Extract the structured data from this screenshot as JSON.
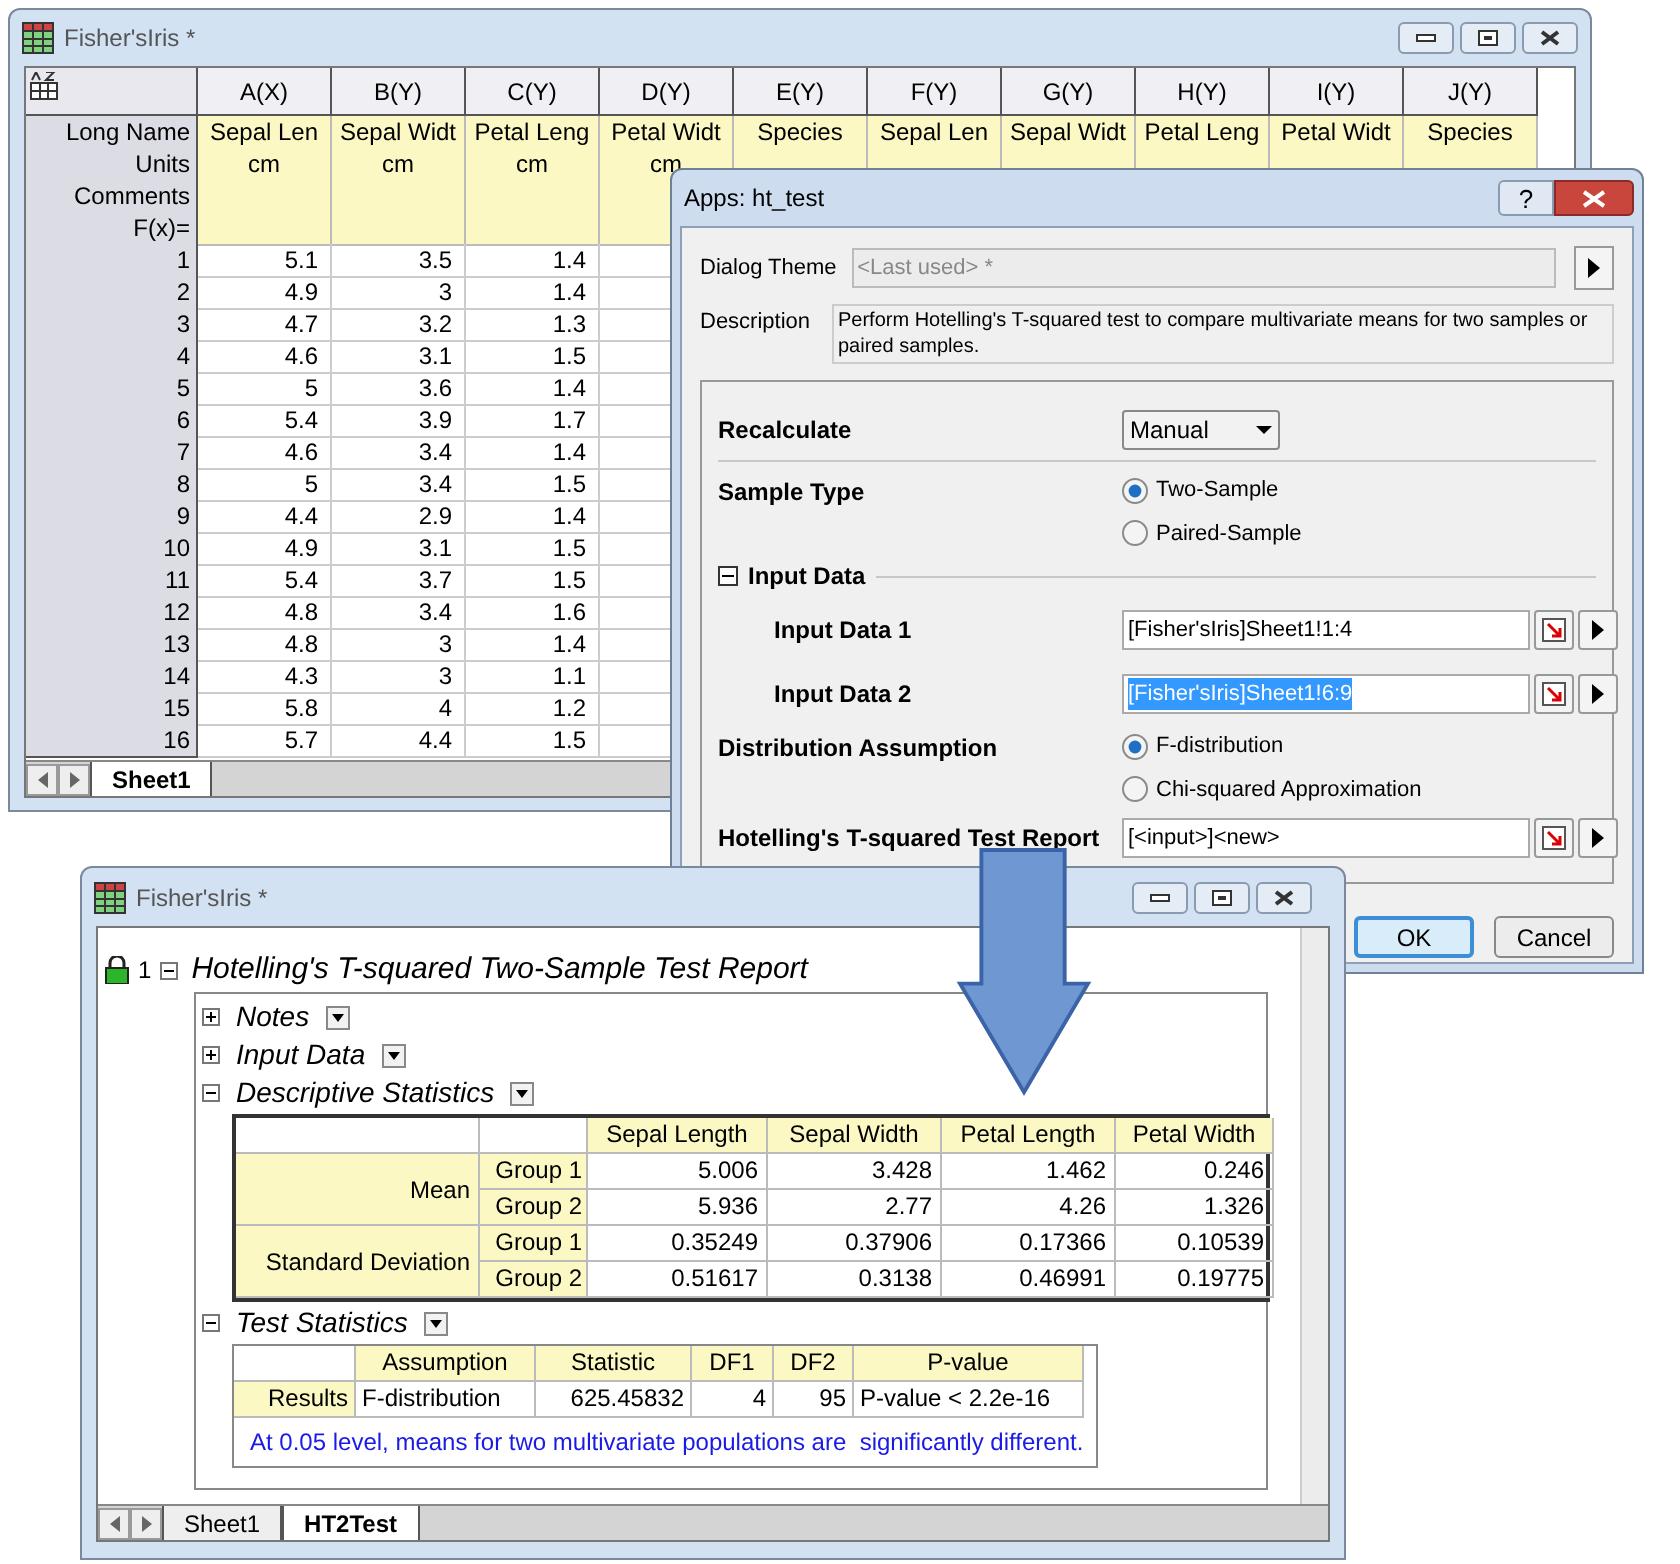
{
  "sheet_window": {
    "title": "Fisher'sIris *",
    "columns": [
      "A(X)",
      "B(Y)",
      "C(Y)",
      "D(Y)",
      "E(Y)",
      "F(Y)",
      "G(Y)",
      "H(Y)",
      "I(Y)",
      "J(Y)"
    ],
    "label_rows": [
      {
        "label": "Long Name",
        "values": [
          "Sepal Len",
          "Sepal Widt",
          "Petal Leng",
          "Petal Widt",
          "Species",
          "Sepal Len",
          "Sepal Widt",
          "Petal Leng",
          "Petal Widt",
          "Species"
        ]
      },
      {
        "label": "Units",
        "values": [
          "cm",
          "cm",
          "cm",
          "cm"
        ]
      },
      {
        "label": "Comments",
        "values": []
      },
      {
        "label": "F(x)=",
        "values": []
      }
    ],
    "rows": [
      {
        "label": "1",
        "values": [
          "5.1",
          "3.5",
          "1.4"
        ]
      },
      {
        "label": "2",
        "values": [
          "4.9",
          "3",
          "1.4"
        ]
      },
      {
        "label": "3",
        "values": [
          "4.7",
          "3.2",
          "1.3"
        ]
      },
      {
        "label": "4",
        "values": [
          "4.6",
          "3.1",
          "1.5"
        ]
      },
      {
        "label": "5",
        "values": [
          "5",
          "3.6",
          "1.4"
        ]
      },
      {
        "label": "6",
        "values": [
          "5.4",
          "3.9",
          "1.7"
        ]
      },
      {
        "label": "7",
        "values": [
          "4.6",
          "3.4",
          "1.4"
        ]
      },
      {
        "label": "8",
        "values": [
          "5",
          "3.4",
          "1.5"
        ]
      },
      {
        "label": "9",
        "values": [
          "4.4",
          "2.9",
          "1.4"
        ]
      },
      {
        "label": "10",
        "values": [
          "4.9",
          "3.1",
          "1.5"
        ]
      },
      {
        "label": "11",
        "values": [
          "5.4",
          "3.7",
          "1.5"
        ]
      },
      {
        "label": "12",
        "values": [
          "4.8",
          "3.4",
          "1.6"
        ]
      },
      {
        "label": "13",
        "values": [
          "4.8",
          "3",
          "1.4"
        ]
      },
      {
        "label": "14",
        "values": [
          "4.3",
          "3",
          "1.1"
        ]
      },
      {
        "label": "15",
        "values": [
          "5.8",
          "4",
          "1.2"
        ]
      },
      {
        "label": "16",
        "values": [
          "5.7",
          "4.4",
          "1.5"
        ]
      }
    ],
    "tabs": [
      {
        "label": "Sheet1",
        "selected": true
      }
    ]
  },
  "dialog": {
    "title": "Apps: ht_test",
    "help": "?",
    "theme_label": "Dialog Theme",
    "theme_value": "<Last used> *",
    "description_label": "Description",
    "description": "Perform Hotelling's T-squared test to compare multivariate means for two samples or paired samples.",
    "items": [
      {
        "kind": "dropdown",
        "label": "Recalculate",
        "value": "Manual"
      },
      {
        "kind": "radio",
        "label": "Sample Type",
        "options": [
          {
            "label": "Two-Sample",
            "selected": true
          },
          {
            "label": "Paired-Sample",
            "selected": false
          }
        ]
      },
      {
        "kind": "section",
        "label": "Input Data",
        "expanded": true,
        "children": [
          {
            "kind": "input",
            "label": "Input Data 1",
            "value": "[Fisher'sIris]Sheet1!1:4",
            "highlighted": false
          },
          {
            "kind": "input",
            "label": "Input Data 2",
            "value": "[Fisher'sIris]Sheet1!6:9",
            "highlighted": true
          }
        ]
      },
      {
        "kind": "radio",
        "label": "Distribution Assumption",
        "options": [
          {
            "label": "F-distribution",
            "selected": true
          },
          {
            "label": "Chi-squared Approximation",
            "selected": false
          }
        ]
      },
      {
        "kind": "input",
        "label": "Hotelling's T-squared Test Report",
        "value": "[<input>]<new>",
        "highlighted": false
      }
    ],
    "buttons": [
      {
        "label": "OK",
        "default": true
      },
      {
        "label": "Cancel",
        "default": false
      }
    ]
  },
  "report_window": {
    "title": "Fisher'sIris *",
    "row_number": "1",
    "report_title": "Hotelling's T-squared Two-Sample Test Report",
    "sections": [
      {
        "title": "Notes",
        "expanded": false
      },
      {
        "title": "Input Data",
        "expanded": false
      },
      {
        "kind": "stats_table",
        "title": "Descriptive Statistics",
        "expanded": true,
        "columns": [
          "Sepal Length",
          "Sepal Width",
          "Petal Length",
          "Petal Width"
        ],
        "groups": [
          {
            "label": "Mean",
            "rows": [
              {
                "label": "Group 1",
                "values": [
                  "5.006",
                  "3.428",
                  "1.462",
                  "0.246"
                ]
              },
              {
                "label": "Group 2",
                "values": [
                  "5.936",
                  "2.77",
                  "4.26",
                  "1.326"
                ]
              }
            ]
          },
          {
            "label": "Standard Deviation",
            "rows": [
              {
                "label": "Group 1",
                "values": [
                  "0.35249",
                  "0.37906",
                  "0.17366",
                  "0.10539"
                ]
              },
              {
                "label": "Group 2",
                "values": [
                  "0.51617",
                  "0.3138",
                  "0.46991",
                  "0.19775"
                ]
              }
            ]
          }
        ]
      },
      {
        "kind": "test_table",
        "title": "Test Statistics",
        "expanded": true,
        "columns": [
          "Assumption",
          "Statistic",
          "DF1",
          "DF2",
          "P-value"
        ],
        "rows": [
          {
            "label": "Results",
            "values": [
              "F-distribution",
              "625.45832",
              "4",
              "95",
              "P-value < 2.2e-16"
            ]
          }
        ],
        "note": "At 0.05 level, means for two multivariate populations are  significantly different."
      }
    ],
    "tabs": [
      {
        "label": "Sheet1",
        "selected": false
      },
      {
        "label": "HT2Test",
        "selected": true
      }
    ]
  }
}
